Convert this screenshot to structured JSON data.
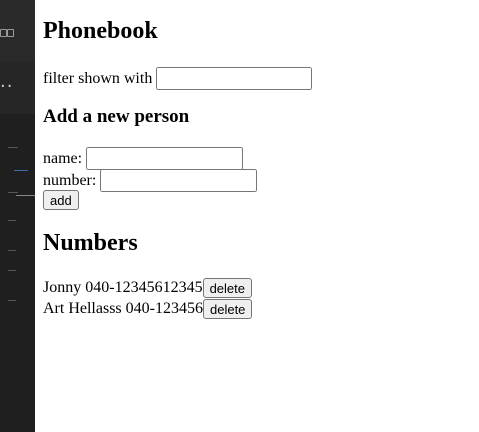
{
  "page": {
    "title": "Phonebook"
  },
  "filter": {
    "label": "filter shown with",
    "value": ""
  },
  "add_form": {
    "heading": "Add a new person",
    "name_label": "name:",
    "name_value": "",
    "number_label": "number:",
    "number_value": "",
    "submit_label": "add"
  },
  "numbers": {
    "heading": "Numbers",
    "persons": [
      {
        "name": "Jonny",
        "number": "040-12345612345",
        "delete_label": "delete"
      },
      {
        "name": "Art Hellasss",
        "number": "040-123456",
        "delete_label": "delete"
      }
    ]
  },
  "colors": {
    "sidebar_bg": "#1f1f1f",
    "page_bg": "#ffffff"
  }
}
